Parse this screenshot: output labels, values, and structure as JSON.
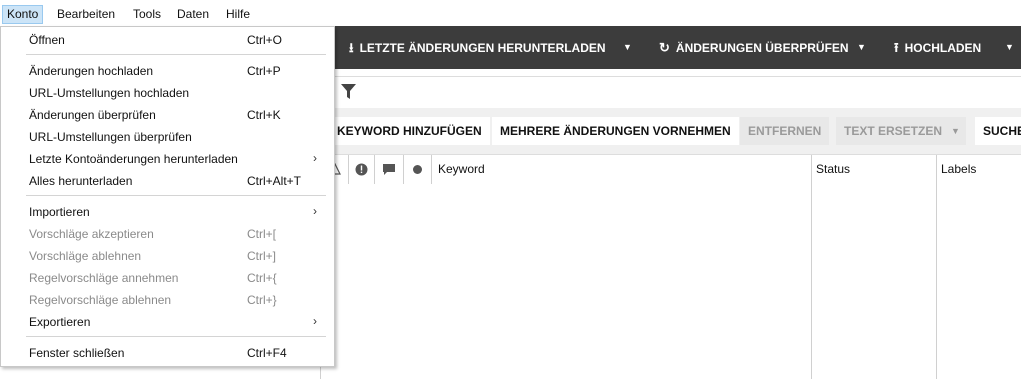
{
  "menubar": {
    "items": [
      "Konto",
      "Bearbeiten",
      "Tools",
      "Daten",
      "Hilfe"
    ]
  },
  "toolbar": {
    "download_label": "LETZTE ÄNDERUNGEN HERUNTERLADEN",
    "check_label": "ÄNDERUNGEN ÜBERPRÜFEN",
    "upload_label": "HOCHLADEN"
  },
  "actions": {
    "add_keyword": "KEYWORD HINZUFÜGEN",
    "multi_changes": "MEHRERE ÄNDERUNGEN VORNEHMEN",
    "remove": "ENTFERNEN",
    "replace_text": "TEXT ERSETZEN",
    "search": "SUCHE"
  },
  "table": {
    "columns": [
      "Keyword",
      "Status",
      "Labels"
    ]
  },
  "menu": {
    "items": [
      {
        "label": "Öffnen",
        "shortcut": "Ctrl+O",
        "disabled": false
      },
      {
        "label": "Änderungen hochladen",
        "shortcut": "Ctrl+P",
        "disabled": false
      },
      {
        "label": "URL-Umstellungen hochladen",
        "shortcut": "",
        "disabled": false
      },
      {
        "label": "Änderungen überprüfen",
        "shortcut": "Ctrl+K",
        "disabled": false
      },
      {
        "label": "URL-Umstellungen überprüfen",
        "shortcut": "",
        "disabled": false
      },
      {
        "label": "Letzte Kontoänderungen herunterladen",
        "shortcut": "",
        "disabled": false,
        "submenu": true
      },
      {
        "label": "Alles herunterladen",
        "shortcut": "Ctrl+Alt+T",
        "disabled": false
      },
      {
        "label": "Importieren",
        "shortcut": "",
        "disabled": false,
        "submenu": true
      },
      {
        "label": "Vorschläge akzeptieren",
        "shortcut": "Ctrl+[",
        "disabled": true
      },
      {
        "label": "Vorschläge ablehnen",
        "shortcut": "Ctrl+]",
        "disabled": true
      },
      {
        "label": "Regelvorschläge annehmen",
        "shortcut": "Ctrl+{",
        "disabled": true
      },
      {
        "label": "Regelvorschläge ablehnen",
        "shortcut": "Ctrl+}",
        "disabled": true
      },
      {
        "label": "Exportieren",
        "shortcut": "",
        "disabled": false,
        "submenu": true
      },
      {
        "label": "Fenster schließen",
        "shortcut": "Ctrl+F4",
        "disabled": false
      }
    ]
  },
  "colors": {
    "toolbar_bg": "#3c3c3c",
    "menu_highlight": "#cce4f7",
    "disabled_text": "#8a8a8a"
  }
}
